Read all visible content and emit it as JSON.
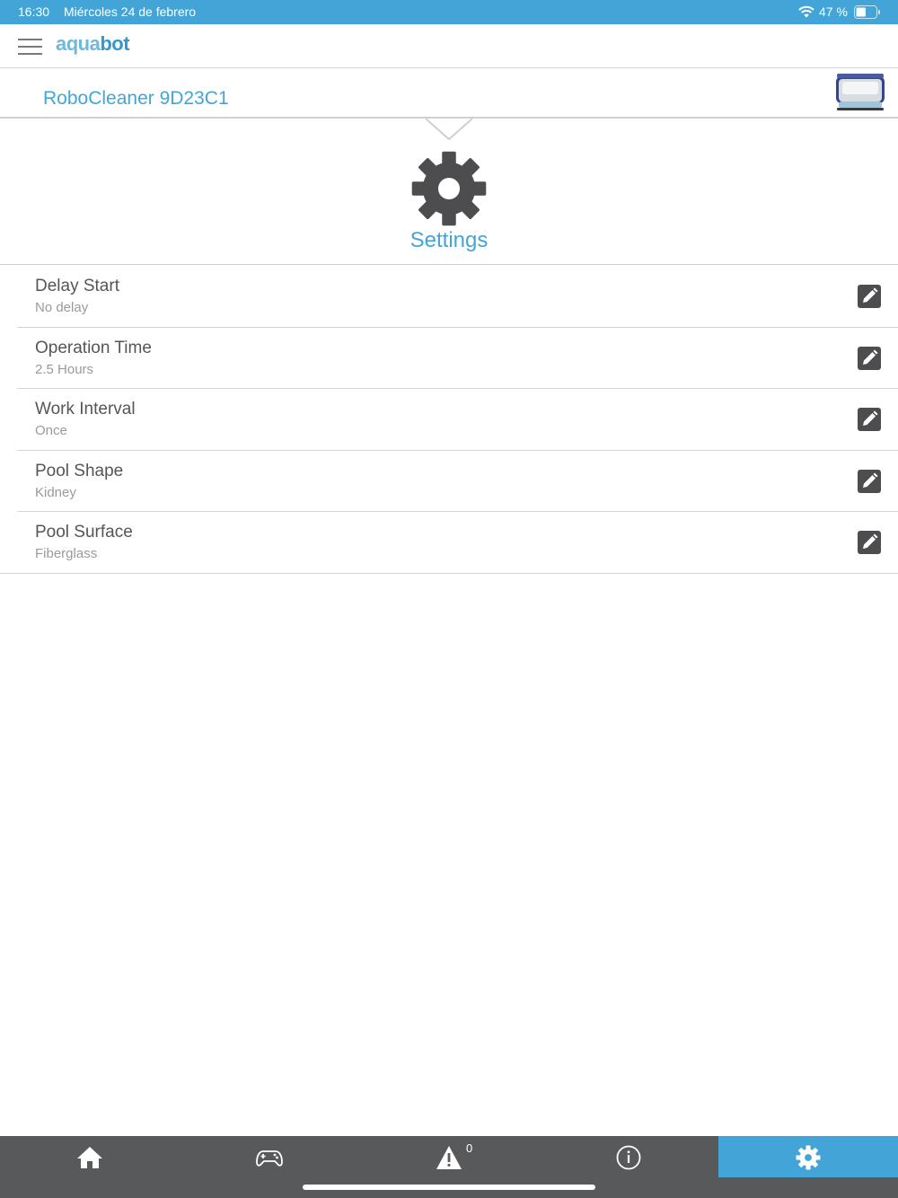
{
  "status_bar": {
    "time": "16:30",
    "date": "Miércoles 24 de febrero",
    "battery": "47 %"
  },
  "header": {
    "logo_part1": "aqua",
    "logo_part2": "bot"
  },
  "device": {
    "name": "RoboCleaner 9D23C1"
  },
  "page": {
    "title": "Settings"
  },
  "settings": [
    {
      "title": "Delay Start",
      "value": "No delay"
    },
    {
      "title": "Operation Time",
      "value": "2.5 Hours"
    },
    {
      "title": "Work Interval",
      "value": "Once"
    },
    {
      "title": "Pool Shape",
      "value": "Kidney"
    },
    {
      "title": "Pool Surface",
      "value": "Fiberglass"
    }
  ],
  "tabs": {
    "alerts_count": "0",
    "items": [
      {
        "icon": "home-icon"
      },
      {
        "icon": "gamepad-icon"
      },
      {
        "icon": "warning-icon"
      },
      {
        "icon": "info-icon"
      },
      {
        "icon": "gear-icon",
        "active": true
      }
    ]
  },
  "colors": {
    "accent": "#43a5d7",
    "tab_bar": "#58595b",
    "icon_dark": "#4d4d4f"
  }
}
